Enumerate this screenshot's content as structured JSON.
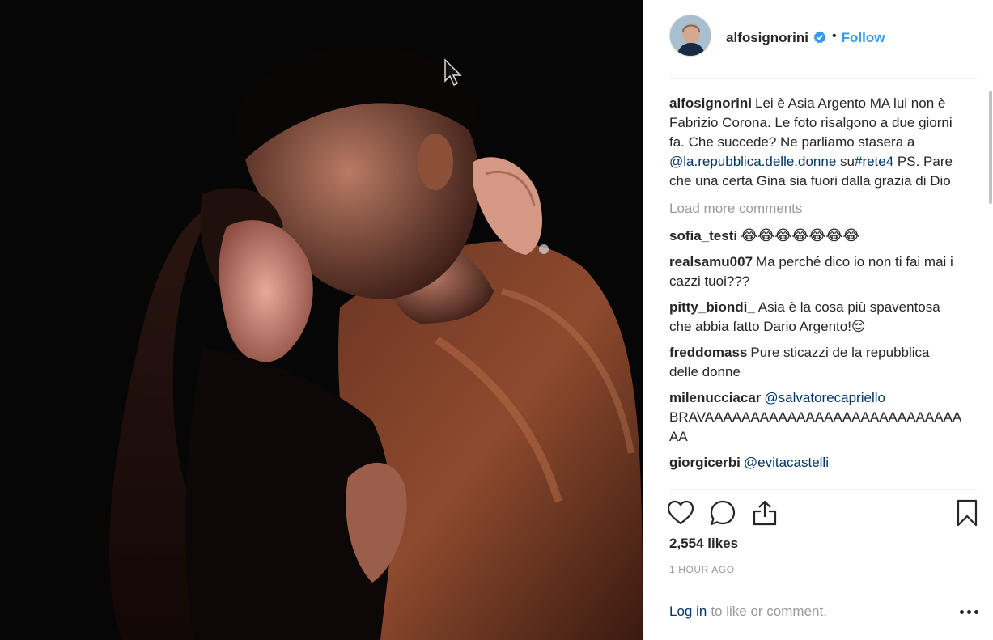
{
  "post": {
    "username": "alfosignorini",
    "follow_label": "Follow",
    "separator": "•",
    "caption_user": "alfosignorini",
    "caption_text_1": "Lei è Asia Argento MA lui non è Fabrizio Corona. Le foto risalgono a due giorni fa. Che succede? Ne parliamo stasera a ",
    "caption_mention": "@la.repubblica.delle.donne",
    "caption_text_2": " su",
    "caption_hashtag": "#rete4",
    "caption_text_3": " PS. Pare che una certa Gina sia fuori dalla grazia di Dio",
    "load_more": "Load more comments",
    "likes": "2,554 likes",
    "time": "1 HOUR AGO",
    "login_link": "Log in",
    "login_rest": "to like or comment."
  },
  "comments": [
    {
      "user": "sofia_testi",
      "text": "😂😂😂😂😂😂😂"
    },
    {
      "user": "realsamu007",
      "text": "Ma perché dico io non ti fai mai i cazzi tuoi???"
    },
    {
      "user": "pitty_biondi_",
      "text": "Asia è la cosa più spaventosa che abbia fatto Dario Argento!😌"
    },
    {
      "user": "freddomass",
      "text": "Pure sticazzi de la repubblica delle donne"
    },
    {
      "user": "milenucciacar",
      "mention": "@salvatorecapriello",
      "text": "BRAVAAAAAAAAAAAAAAAAAAAAAAAAAAAAAA"
    },
    {
      "user": "giorgicerbi",
      "mention": "@evitacastelli",
      "text": ""
    }
  ],
  "icons": {
    "avatar": "avatar",
    "verified": "verified-badge-icon",
    "like": "heart-icon",
    "comment": "speech-bubble-icon",
    "share": "share-icon",
    "save": "bookmark-icon",
    "more": "ellipsis-icon",
    "cursor": "mouse-pointer-icon"
  },
  "colors": {
    "link": "#3897f0",
    "mention": "#003569",
    "muted": "#999999",
    "text": "#262626"
  }
}
